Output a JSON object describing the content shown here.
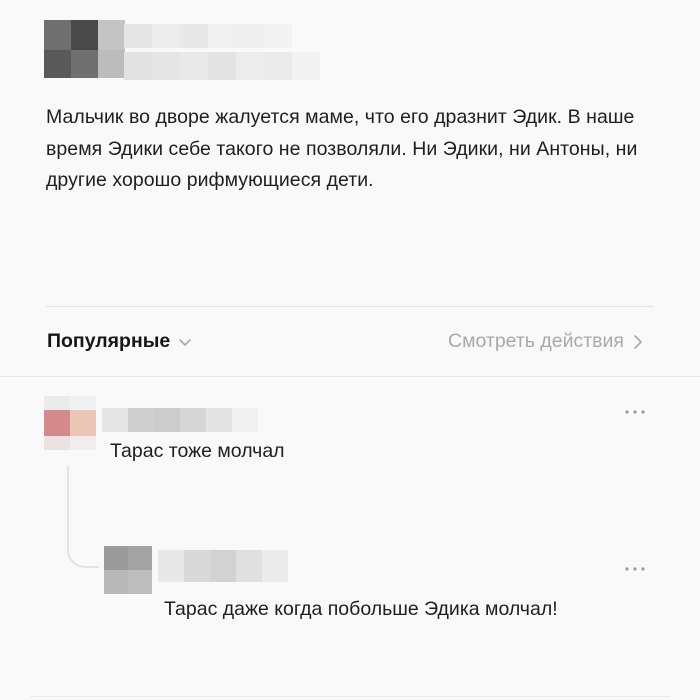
{
  "post": {
    "author_avatar_icon": "pixelated-avatar-icon",
    "text": "Мальчик во дворе жалуется маме, что его дразнит Эдик. В наше время Эдики себе такого не позволяли. Ни Эдики, ни Антоны, ни другие хорошо рифмующиеся дети."
  },
  "comments_header": {
    "sort_label": "Популярные",
    "sort_icon": "chevron-down-icon",
    "actions_label": "Смотреть действия",
    "actions_icon": "chevron-right-icon"
  },
  "comments": [
    {
      "avatar_icon": "pixelated-avatar-icon",
      "text": "Тарас тоже молчал",
      "menu_icon": "more-dots-icon",
      "replies": [
        {
          "avatar_icon": "pixelated-avatar-icon",
          "text": "Тарас даже когда побольше Эдика молчал!",
          "menu_icon": "more-dots-icon"
        }
      ]
    }
  ],
  "colors": {
    "background": "#f9f9f9",
    "text": "#1e1e1e",
    "muted": "#a9a9a9",
    "divider": "#e4e4e4"
  }
}
